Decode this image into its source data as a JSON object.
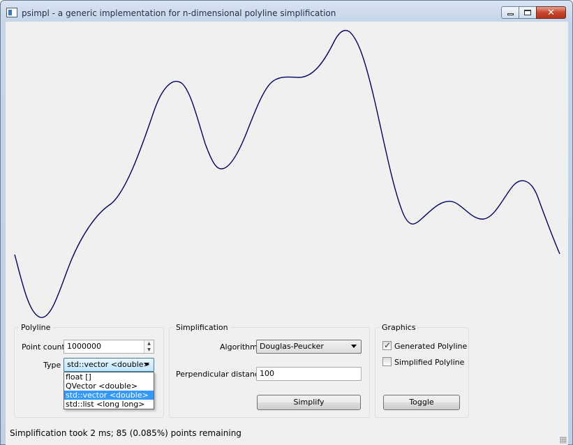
{
  "window": {
    "title": "psimpl - a generic implementation for n-dimensional polyline simplification",
    "minimize_glyph": "",
    "close_glyph": "✕"
  },
  "plot": {
    "line_color": "#000066",
    "shape": "smooth polyline"
  },
  "polyline_group": {
    "title": "Polyline",
    "point_count_label": "Point count",
    "point_count_value": "1000000",
    "type_label": "Type",
    "type_value": "std::vector <double>",
    "type_options": [
      "float []",
      "QVector <double>",
      "std::vector <double>",
      "std::list <long long>"
    ],
    "type_selected_index": 2
  },
  "simplification_group": {
    "title": "Simplification",
    "algorithm_label": "Algorithm",
    "algorithm_value": "Douglas-Peucker",
    "distance_label": "Perpendicular distance",
    "distance_value": "100",
    "simplify_button": "Simplify"
  },
  "graphics_group": {
    "title": "Graphics",
    "generated_label": "Generated Polyline",
    "generated_checked": true,
    "simplified_label": "Simplified Polyline",
    "simplified_checked": false,
    "toggle_button": "Toggle"
  },
  "status": {
    "text": "Simplification took 2 ms; 85 (0.085%) points remaining"
  },
  "colors": {
    "selection": "#3399ff",
    "window_frame": "#bfd0e5",
    "client_bg": "#f0f0f0"
  }
}
